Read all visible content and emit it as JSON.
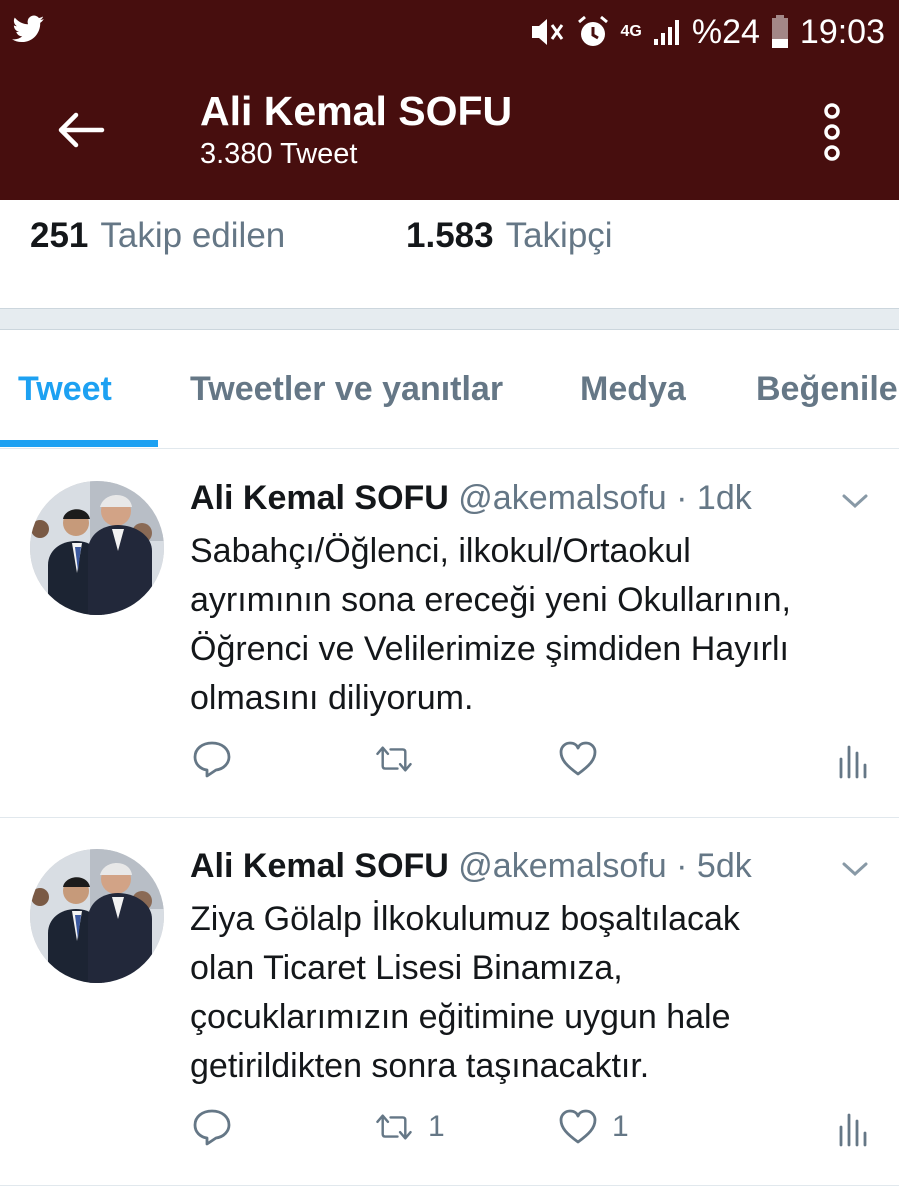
{
  "status_bar": {
    "battery": "%24",
    "time": "19:03",
    "network": "4G"
  },
  "header": {
    "title": "Ali Kemal SOFU",
    "subtitle": "3.380 Tweet"
  },
  "stats": {
    "following_count": "251",
    "following_label": "Takip edilen",
    "followers_count": "1.583",
    "followers_label": "Takipçi"
  },
  "tabs": [
    {
      "label": "Tweet",
      "active": true
    },
    {
      "label": "Tweetler ve yanıtlar",
      "active": false
    },
    {
      "label": "Medya",
      "active": false
    },
    {
      "label": "Beğenile",
      "active": false
    }
  ],
  "tweets": [
    {
      "name": "Ali Kemal SOFU",
      "handle": "@akemalsofu",
      "time": "· 1dk",
      "lines": [
        "Sabahçı/Öğlenci, ilkokul/Ortaokul",
        "ayrımının sona ereceği yeni Okullarının,",
        "Öğrenci ve Velilerimize şimdiden Hayırlı",
        "olmasını diliyorum."
      ],
      "retweets": "",
      "likes": ""
    },
    {
      "name": "Ali Kemal SOFU",
      "handle": "@akemalsofu",
      "time": "· 5dk",
      "lines": [
        "Ziya Gölalp İlkokulumuz boşaltılacak",
        "olan Ticaret Lisesi Binamıza,",
        "çocuklarımızın eğitimine uygun hale",
        "getirildikten sonra taşınacaktır."
      ],
      "retweets": "1",
      "likes": "1"
    }
  ],
  "colors": {
    "header_bg": "#470e0e",
    "accent": "#1da1f2",
    "muted": "#657786"
  }
}
